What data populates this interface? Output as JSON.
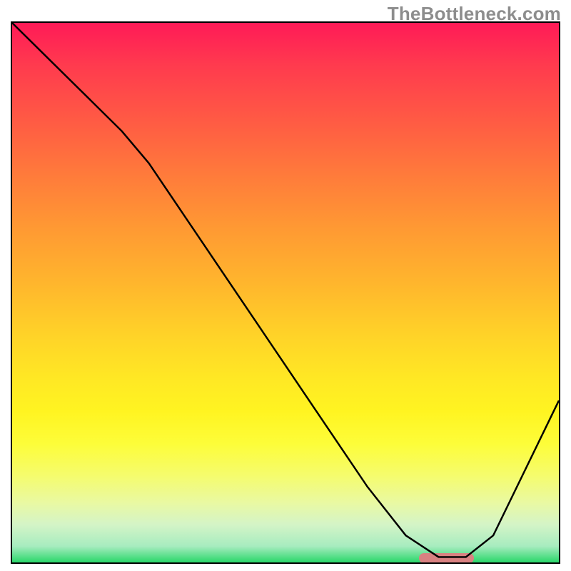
{
  "watermark": "TheBottleneck.com",
  "colors": {
    "border": "#000000",
    "curve": "#000000",
    "optimal_bar": "#d98181",
    "watermark": "#8d8d8d"
  },
  "chart_data": {
    "type": "line",
    "title": "",
    "xlabel": "",
    "ylabel": "",
    "xlim": [
      0,
      100
    ],
    "ylim": [
      0,
      100
    ],
    "grid": false,
    "legend": false,
    "series": [
      {
        "name": "bottleneck-curve",
        "x": [
          0,
          10,
          20,
          25,
          35,
          45,
          55,
          65,
          72,
          78,
          83,
          88,
          100
        ],
        "values": [
          100,
          90,
          80,
          74,
          59,
          44,
          29,
          14,
          5,
          1,
          1,
          5,
          30
        ]
      }
    ],
    "optimal_range": {
      "x_start": 74,
      "x_end": 84,
      "y": 1
    },
    "background_gradient_note": "vertical rainbow red→green represents bottleneck severity (y-axis) as a heat background"
  }
}
